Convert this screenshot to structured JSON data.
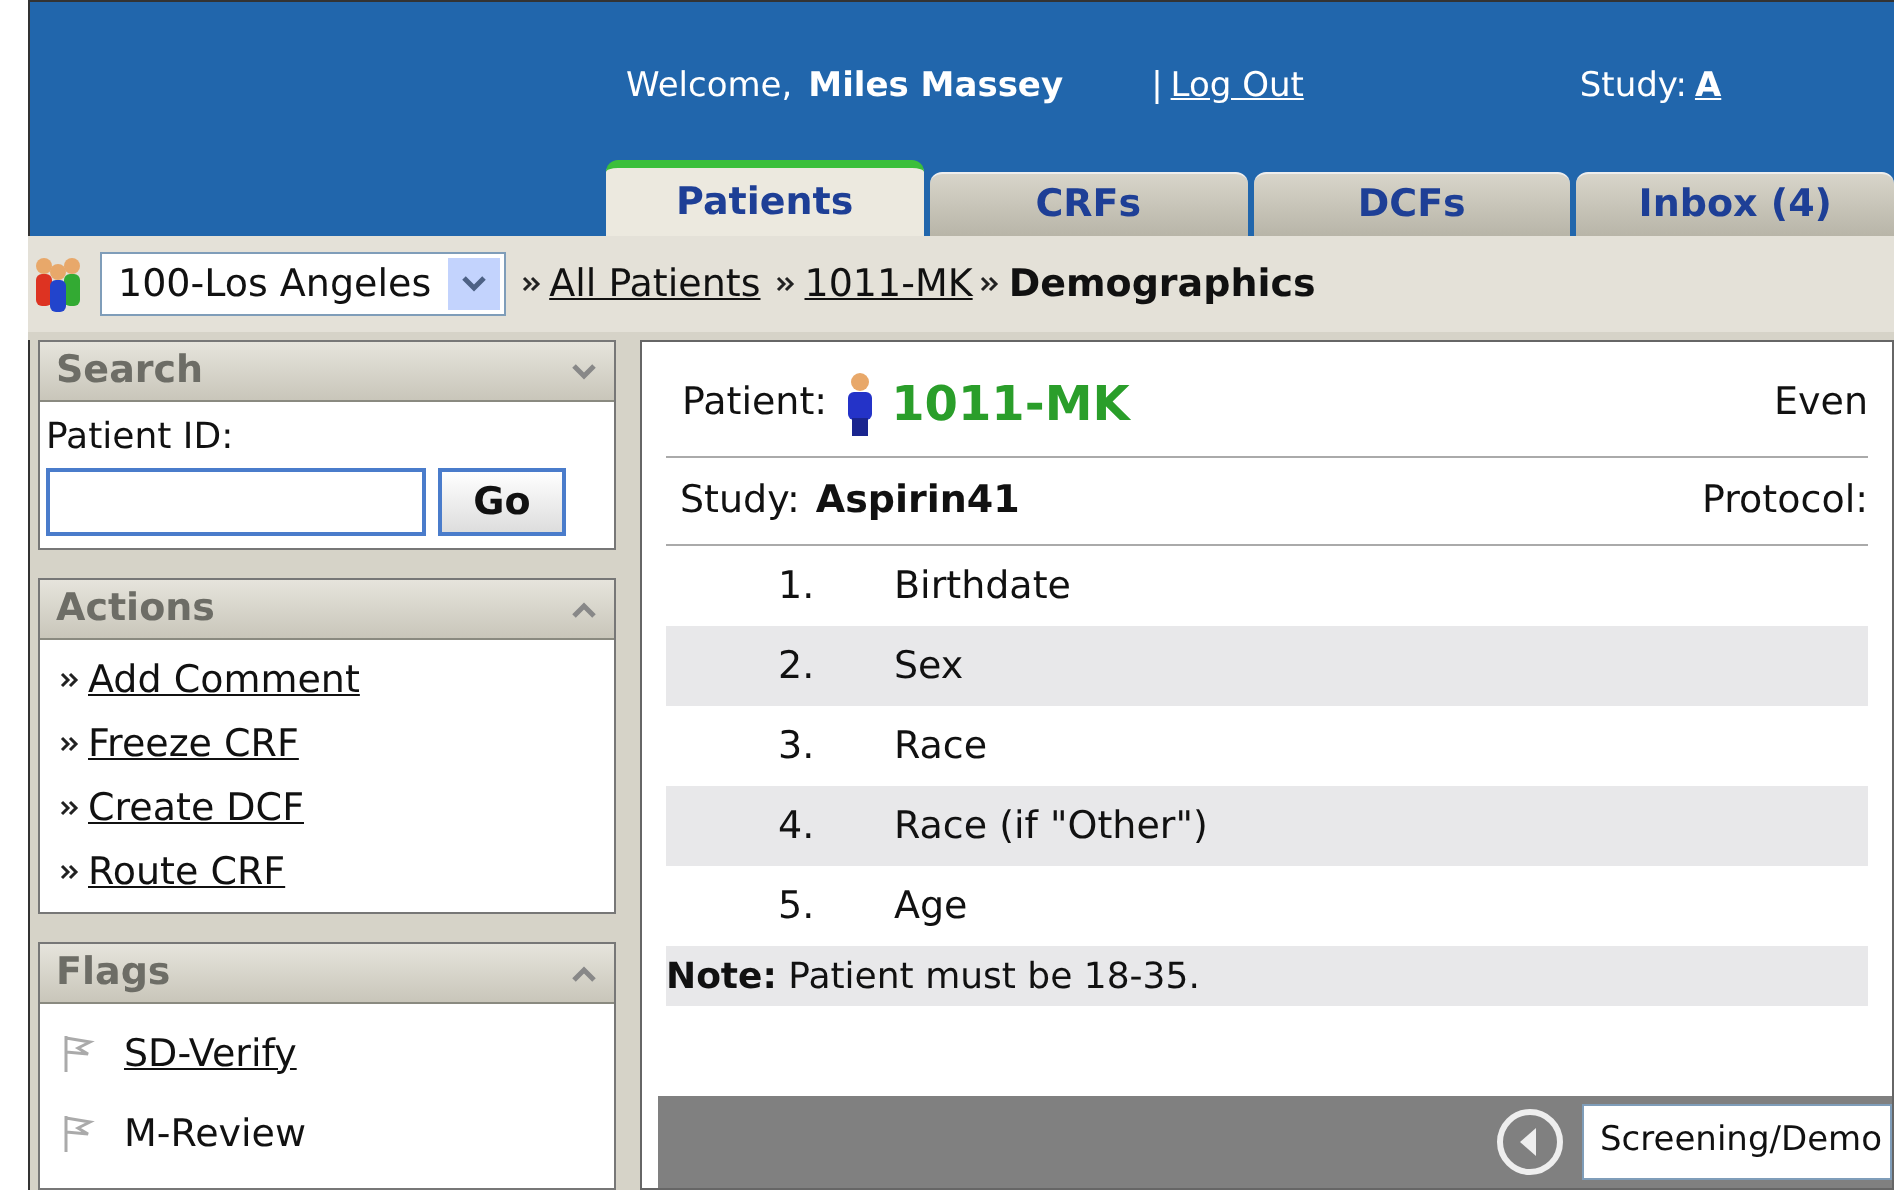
{
  "header": {
    "welcome_label": "Welcome,",
    "user_name": "Miles Massey",
    "separator": "|",
    "logout_link": "Log Out",
    "study_label": "Study:",
    "study_link": "A"
  },
  "tabs": [
    {
      "label": "Patients",
      "selected": true
    },
    {
      "label": "CRFs",
      "selected": false
    },
    {
      "label": "DCFs",
      "selected": false
    },
    {
      "label": "Inbox (4)",
      "selected": false
    }
  ],
  "breadcrumb": {
    "site_select": "100-Los Angeles",
    "links": [
      "All Patients",
      "1011-MK"
    ],
    "current": "Demographics"
  },
  "sidebar": {
    "search": {
      "title": "Search",
      "field_label": "Patient ID:",
      "go_button": "Go"
    },
    "actions": {
      "title": "Actions",
      "items": [
        "Add Comment",
        "Freeze CRF",
        "Create DCF",
        "Route CRF"
      ]
    },
    "flags": {
      "title": "Flags",
      "items": [
        {
          "label": "SD-Verify",
          "link": true
        },
        {
          "label": "M-Review",
          "link": false
        }
      ]
    }
  },
  "main": {
    "patient_label": "Patient:",
    "patient_id": "1011-MK",
    "event_label": "Even",
    "study_label": "Study:",
    "study_value": "Aspirin41",
    "protocol_label": "Protocol:",
    "questions": [
      {
        "number": "1.",
        "label": "Birthdate"
      },
      {
        "number": "2.",
        "label": "Sex"
      },
      {
        "number": "3.",
        "label": "Race"
      },
      {
        "number": "4.",
        "label": "Race (if \"Other\")"
      },
      {
        "number": "5.",
        "label": "Age"
      }
    ],
    "note": "**Note:** Patient must be 18-35.",
    "footer_select": "Screening/Demo"
  }
}
